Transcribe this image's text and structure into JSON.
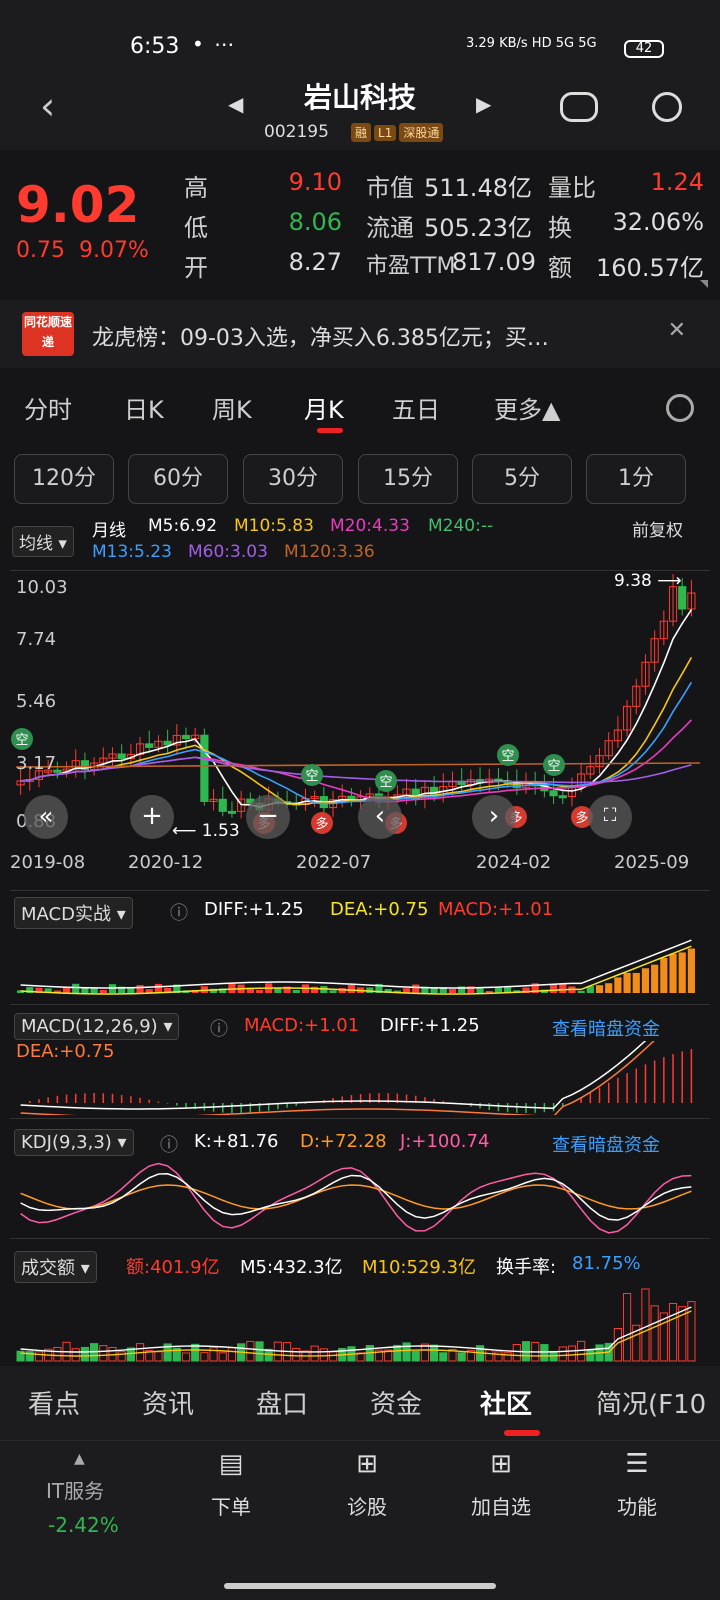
{
  "status": {
    "time": "6:53",
    "dots": "• ⋯",
    "net": "3.29 KB/s  HD  5G  5G",
    "battery": "42"
  },
  "header": {
    "name": "岩山科技",
    "code": "002195",
    "tags": [
      "融",
      "L1",
      "深股通"
    ]
  },
  "quote": {
    "price": "9.02",
    "change": "0.75",
    "change_pct": "9.07%",
    "high_label": "高",
    "high": "9.10",
    "low_label": "低",
    "low": "8.06",
    "open_label": "开",
    "open": "8.27",
    "mktcap_label": "市值",
    "mktcap": "511.48亿",
    "float_label": "流通",
    "float": "505.23亿",
    "pe_label": "市盈TTM",
    "pe": "817.09",
    "volratio_label": "量比",
    "volratio": "1.24",
    "turnover_label": "换",
    "turnover": "32.06%",
    "amount_label": "额",
    "amount": "160.57亿"
  },
  "news": {
    "logo": "同花顺速递",
    "text": "龙虎榜：09-03入选，净买入6.385亿元；买…"
  },
  "tabs": [
    "分时",
    "日K",
    "周K",
    "月K",
    "五日",
    "更多▲"
  ],
  "periods": [
    "120分",
    "60分",
    "30分",
    "15分",
    "5分",
    "1分"
  ],
  "ma": {
    "selector": "均线",
    "type": "月线",
    "fq": "前复权",
    "m5": "M5:6.92",
    "m10": "M10:5.83",
    "m20": "M20:4.33",
    "m240": "M240:--",
    "m13": "M13:5.23",
    "m60": "M60:3.03",
    "m120": "M120:3.36"
  },
  "kchart": {
    "yticks": [
      "10.03",
      "7.74",
      "5.46",
      "3.17",
      "0.88"
    ],
    "xticks": [
      "2019-08",
      "2020-12",
      "2022-07",
      "2024-02",
      "2025-09"
    ],
    "max_label": "9.38",
    "min_label": "1.53",
    "signals": [
      "空",
      "空",
      "空",
      "空",
      "空",
      "多",
      "多",
      "多",
      "多",
      "多"
    ]
  },
  "macd_zs": {
    "title": "MACD实战",
    "diff": "DIFF:+1.25",
    "dea": "DEA:+0.75",
    "macd": "MACD:+1.01"
  },
  "macd": {
    "title": "MACD(12,26,9)",
    "macd": "MACD:+1.01",
    "diff": "DIFF:+1.25",
    "dea": "DEA:+0.75",
    "link": "查看暗盘资金"
  },
  "kdj": {
    "title": "KDJ(9,3,3)",
    "k": "K:+81.76",
    "d": "D:+72.28",
    "j": "J:+100.74",
    "link": "查看暗盘资金"
  },
  "volume": {
    "title": "成交额",
    "amount": "额:401.9亿",
    "m5": "M5:432.3亿",
    "m10": "M10:529.3亿",
    "turnover_label": "换手率:",
    "turnover": "81.75%"
  },
  "bottom_tabs": [
    "看点",
    "资讯",
    "盘口",
    "资金",
    "社区",
    "简况(F10"
  ],
  "nav": {
    "sector": "IT服务",
    "sector_chg": "-2.42%",
    "items": [
      "下单",
      "诊股",
      "加自选",
      "功能"
    ]
  },
  "colors": {
    "up": "#ff3b30",
    "down": "#2fb84f",
    "bg": "#151517"
  }
}
